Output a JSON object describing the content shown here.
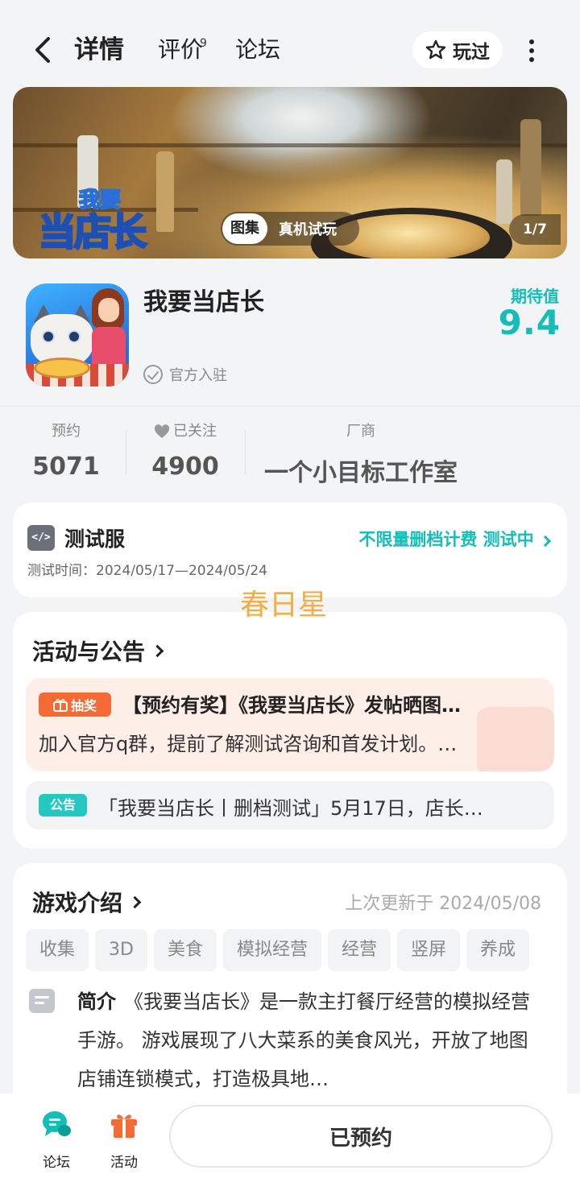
{
  "header": {
    "tabs": [
      "详情",
      "评价",
      "论坛"
    ],
    "review_count": "9",
    "played_label": "玩过"
  },
  "banner": {
    "logo_line1": "我要",
    "logo_line2": "当店长",
    "chip_gallery": "图集",
    "chip_trial": "真机试玩",
    "page_indicator": "1/7"
  },
  "app": {
    "title": "我要当店长",
    "official_label": "官方入驻",
    "expect_label": "期待值",
    "expect_value": "9.4"
  },
  "stats": {
    "reserve_label": "预约",
    "reserve_value": "5071",
    "follow_label": "已关注",
    "follow_value": "4900",
    "vendor_label": "厂商",
    "vendor_value": "一个小目标工作室"
  },
  "test": {
    "icon_text": "</>",
    "title": "测试服",
    "status": "不限量删档计费 测试中",
    "time": "测试时间：2024/05/17—2024/05/24"
  },
  "watermark": "春日星",
  "events": {
    "title": "活动与公告",
    "lottery_tag": "抽奖",
    "event_title": "【预约有奖】《我要当店长》发帖晒图…",
    "event_desc": "加入官方q群，提前了解测试咨询和首发计划。…",
    "notice_tag": "公告",
    "notice_text": "「我要当店长丨删档测试」5月17日，店长…"
  },
  "intro": {
    "title": "游戏介绍",
    "update_time": "上次更新于 2024/05/08",
    "tags": [
      "收集",
      "3D",
      "美食",
      "模拟经营",
      "经营",
      "竖屏",
      "养成"
    ],
    "brief_label": "简介",
    "brief_text": "《我要当店长》是一款主打餐厅经营的模拟经营手游。 游戏展现了八大菜系的美食风光，开放了地图店铺连锁模式，打造极具地…"
  },
  "bottom": {
    "forum_label": "论坛",
    "activity_label": "活动",
    "reserve_button": "已预约"
  },
  "colors": {
    "accent": "#14bdb7",
    "lottery": "#f66a36",
    "watermark": "#f3ae45"
  }
}
